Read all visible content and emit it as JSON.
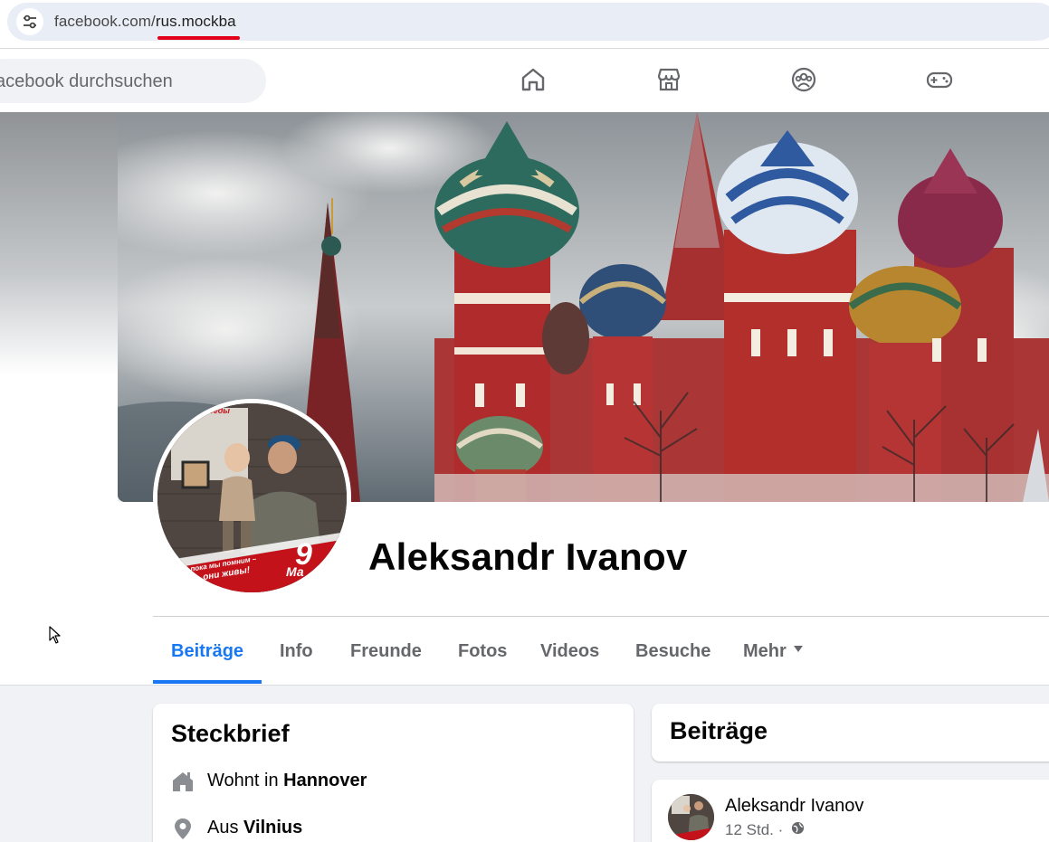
{
  "browser": {
    "url_domain": "facebook.com/",
    "url_path": "rus.mockba",
    "site_info_icon": "tune-icon"
  },
  "topbar": {
    "search_placeholder": "acebook durchsuchen",
    "nav_icons": [
      "home-icon",
      "marketplace-icon",
      "groups-icon",
      "gaming-icon"
    ]
  },
  "profile": {
    "name": "Aleksandr Ivanov",
    "avatar_text_top": "беды",
    "avatar_banner_line1": "пока мы помним –",
    "avatar_banner_line2": "они живы!",
    "avatar_badge": "9",
    "avatar_badge_sub": "Ма"
  },
  "tabs": [
    {
      "label": "Beiträge",
      "active": true
    },
    {
      "label": "Info",
      "active": false
    },
    {
      "label": "Freunde",
      "active": false
    },
    {
      "label": "Fotos",
      "active": false
    },
    {
      "label": "Videos",
      "active": false
    },
    {
      "label": "Besuche",
      "active": false
    },
    {
      "label": "Mehr",
      "active": false
    }
  ],
  "intro": {
    "title": "Steckbrief",
    "rows": [
      {
        "icon": "house-icon",
        "prefix": "Wohnt in ",
        "value": "Hannover"
      },
      {
        "icon": "location-pin-icon",
        "prefix": "Aus ",
        "value": "Vilnius"
      }
    ]
  },
  "posts": {
    "title": "Beiträge",
    "first_post": {
      "author": "Aleksandr Ivanov",
      "time": "12 Std. ·",
      "audience_icon": "globe-icon"
    }
  },
  "colors": {
    "fb_blue": "#1877f2",
    "secondary_text": "#65676b",
    "url_underline": "#e3001b"
  }
}
